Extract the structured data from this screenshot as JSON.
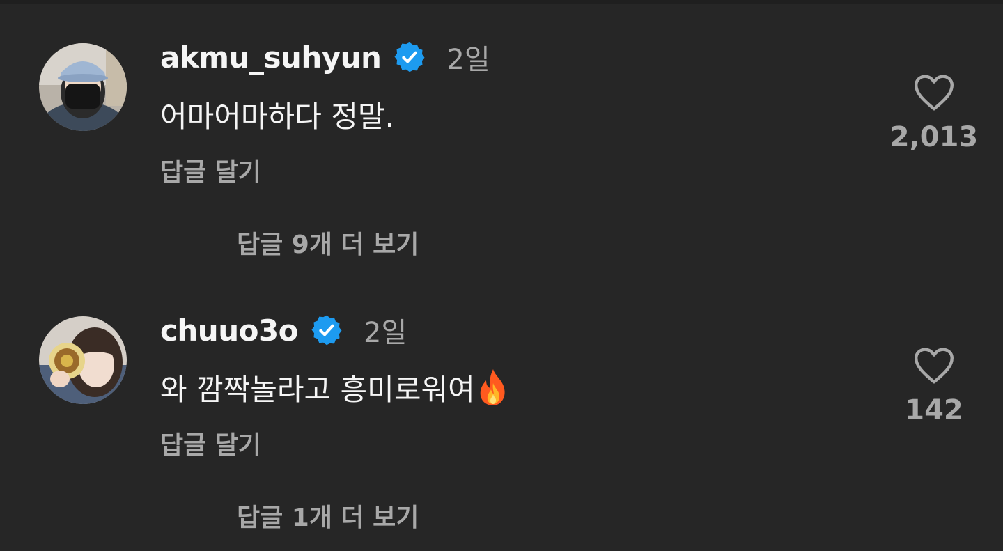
{
  "comments": [
    {
      "username": "akmu_suhyun",
      "verified": true,
      "time": "2일",
      "text": "어마어마하다 정말.",
      "emoji": "",
      "reply_label": "답글 달기",
      "likes": "2,013",
      "more_replies": "답글 9개 더 보기"
    },
    {
      "username": "chuuo3o",
      "verified": true,
      "time": "2일",
      "text": "와 깜짝놀라고 흥미로워여",
      "emoji": "fire-emoji",
      "reply_label": "답글 달기",
      "likes": "142",
      "more_replies": "답글 1개 더 보기"
    }
  ],
  "colors": {
    "background": "#262626",
    "primary_text": "#f5f5f5",
    "secondary_text": "#a8a8a8",
    "verified_badge": "#1d9bf0"
  }
}
